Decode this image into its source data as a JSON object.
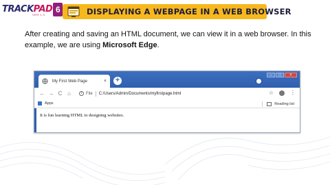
{
  "logo": {
    "text_main": "TRACK",
    "text_accent": "PAD",
    "badge": "6",
    "sub": "VER 1.0"
  },
  "banner": {
    "title": "DISPLAYING A WEBPAGE IN A WEB BROWSER"
  },
  "paragraph": {
    "text_before": "After creating and saving an HTML document, we can view it in a web browser. In this example, we are using ",
    "emphasis": "Microsoft Edge",
    "text_after": "."
  },
  "browser": {
    "tab": {
      "title": "My First Web Page",
      "close": "×"
    },
    "new_tab": "+",
    "window_controls": {
      "minimize": "–",
      "maximize": "□",
      "close": "×"
    },
    "nav": {
      "back": "←",
      "forward": "→",
      "reload": "C",
      "home": "⌂"
    },
    "address": {
      "scheme_label": "File",
      "url": "C:/Users/Admin/Documents/myfirstpage.html"
    },
    "toolbar": {
      "star": "☆",
      "menu": "⋮"
    },
    "bookmarks": {
      "apps": "Apps",
      "reading_list": "Reading list"
    },
    "page_content": "It is fun learning HTML to designing websites."
  },
  "colors": {
    "banner": "#f7b81e",
    "tabbar": "#3e6fbf",
    "logo_badge": "#8e1f7a"
  }
}
